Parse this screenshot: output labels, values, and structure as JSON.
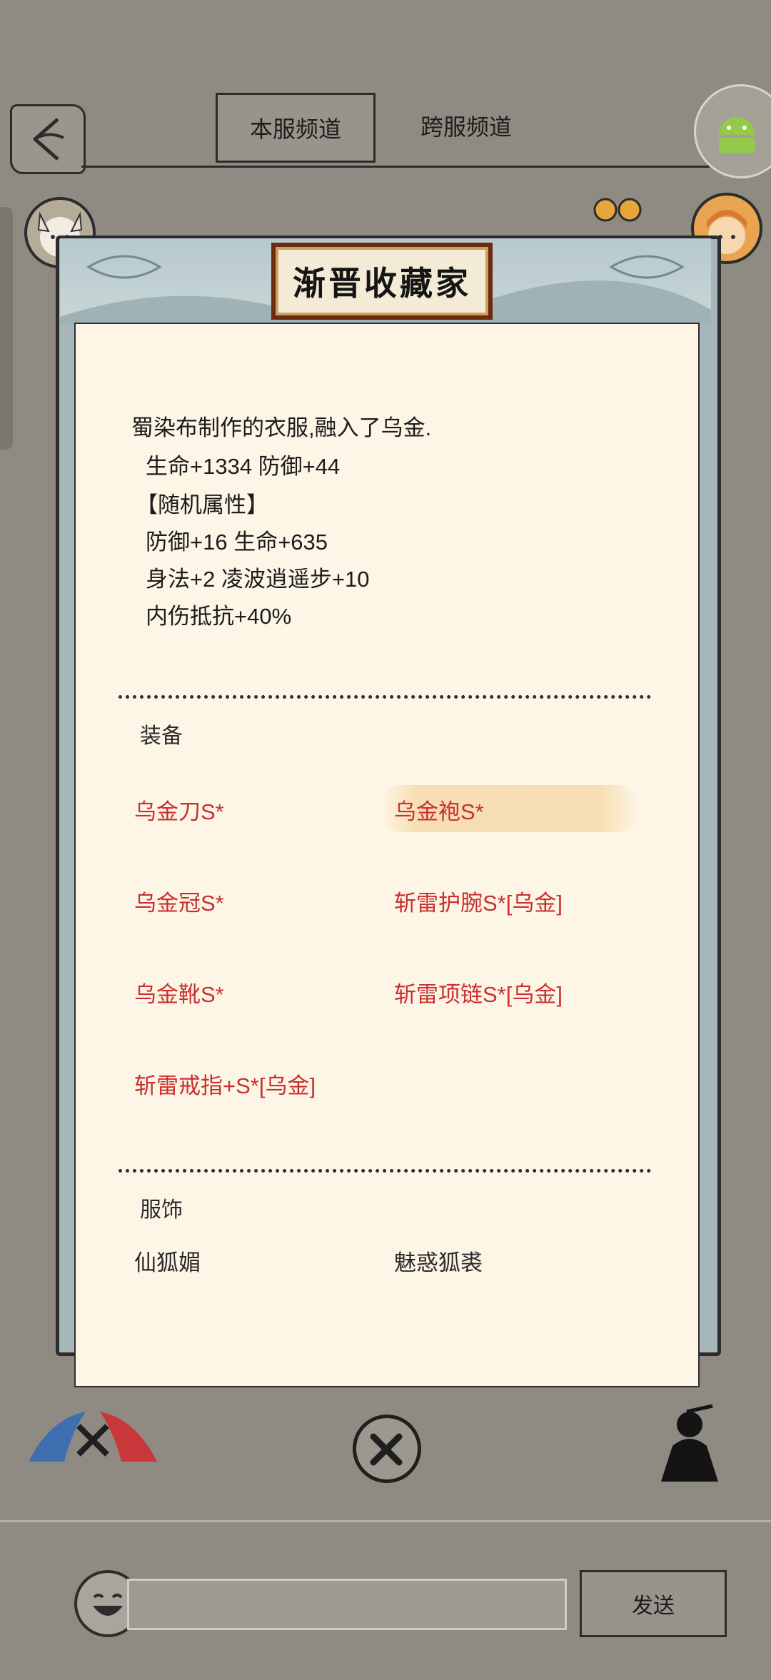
{
  "header": {
    "tabs": [
      {
        "label": "本服频道",
        "active": true
      },
      {
        "label": "跨服频道",
        "active": false
      }
    ]
  },
  "dialog": {
    "title": "渐晋收藏家",
    "description_lines": [
      "蜀染布制作的衣服,融入了乌金.",
      "生命+1334 防御+44",
      "【随机属性】",
      "防御+16 生命+635",
      "身法+2 凌波逍遥步+10",
      "内伤抵抗+40%"
    ],
    "equipment_section": {
      "label": "装备",
      "items": [
        "乌金刀S*",
        "乌金袍S*",
        "乌金冠S*",
        "斩雷护腕S*[乌金]",
        "乌金靴S*",
        "斩雷项链S*[乌金]",
        "斩雷戒指+S*[乌金]"
      ],
      "selected": "乌金袍S*"
    },
    "costume_section": {
      "label": "服饰",
      "items": [
        "仙狐媚",
        "魅惑狐裘"
      ]
    }
  },
  "chat": {
    "send_label": "发送",
    "input_value": ""
  },
  "colors": {
    "equipment_text": "#c9302f",
    "panel_bg": "#fdf6e6",
    "overlay_bg": "#8f8b83"
  }
}
